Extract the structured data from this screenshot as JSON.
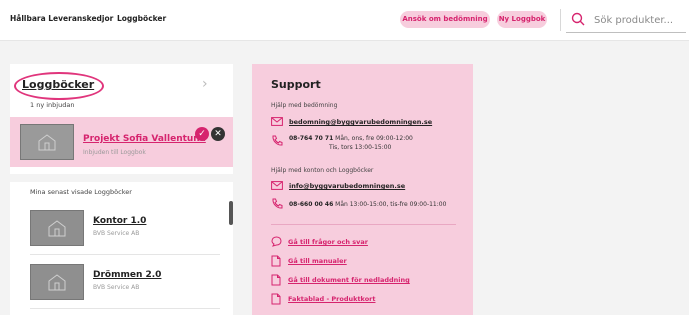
{
  "header": {
    "brand": "Hållbara Leveranskedjor",
    "nav_logbooks": "Loggböcker",
    "apply_button": "Ansök om bedömning",
    "new_logbook_button": "Ny Loggbok",
    "search_placeholder": "Sök produkter..."
  },
  "left_panel": {
    "title": "Loggböcker",
    "invites_count": "1 ny inbjudan",
    "invite": {
      "name": "Projekt Sofia Vallentuna",
      "sub": "Inbjuden till Loggbok"
    },
    "recent_label": "Mina senast visade Loggböcker",
    "projects": [
      {
        "name": "Kontor 1.0",
        "company": "BVB Service AB"
      },
      {
        "name": "Drömmen 2.0",
        "company": "BVB Service AB"
      }
    ]
  },
  "support": {
    "title": "Support",
    "assess_label": "Hjälp med bedömning",
    "assess_email": "bedomning@byggvarubedomningen.se",
    "assess_phone": "08-764 70 71",
    "assess_hours_1": "Mån, ons, fre 09:00-12:00",
    "assess_hours_2": "Tis, tors 13:00-15:00",
    "account_label": "Hjälp med konton och Loggböcker",
    "account_email": "info@byggvarubedomningen.se",
    "account_phone": "08-660 00 46",
    "account_hours": "Mån 13:00-15:00, tis-fre 09:00-11:00",
    "links": [
      "Gå till frågor och svar",
      "Gå till manualer",
      "Gå till dokument för nedladdning",
      "Faktablad - Produktkort"
    ]
  },
  "colors": {
    "accent": "#d6246e",
    "pink_bg": "#f7cddd"
  }
}
